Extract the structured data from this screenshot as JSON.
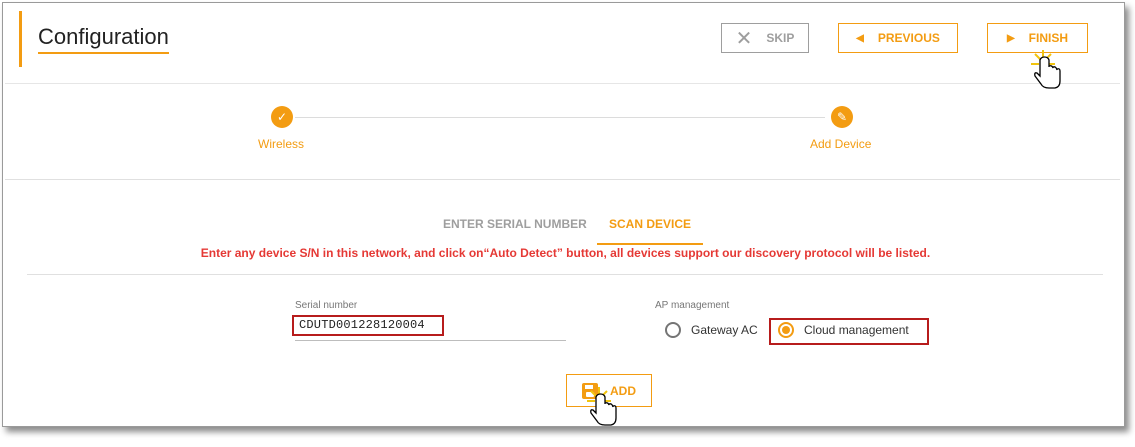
{
  "header": {
    "title": "Configuration",
    "skip_label": "SKIP",
    "previous_label": "PREVIOUS",
    "finish_label": "FINISH"
  },
  "stepper": {
    "steps": [
      {
        "label": "Wireless",
        "state": "completed",
        "icon": "check-icon"
      },
      {
        "label": "Add Device",
        "state": "current",
        "icon": "pencil-icon"
      }
    ]
  },
  "tabs": [
    {
      "label": "ENTER SERIAL NUMBER",
      "active": false
    },
    {
      "label": "SCAN DEVICE",
      "active": true
    }
  ],
  "hint": "Enter any device S/N in this network, and click on“Auto Detect” button, all devices support our discovery protocol will be listed.",
  "form": {
    "serial_label": "Serial number",
    "serial_value": "CDUTD001228120004",
    "ap_label": "AP management",
    "options": [
      {
        "label": "Gateway AC",
        "selected": false
      },
      {
        "label": "Cloud management",
        "selected": true
      }
    ],
    "add_label": "ADD"
  },
  "colors": {
    "accent": "#f39c12",
    "hint": "#e53935",
    "highlight_box": "#b71c1c"
  }
}
